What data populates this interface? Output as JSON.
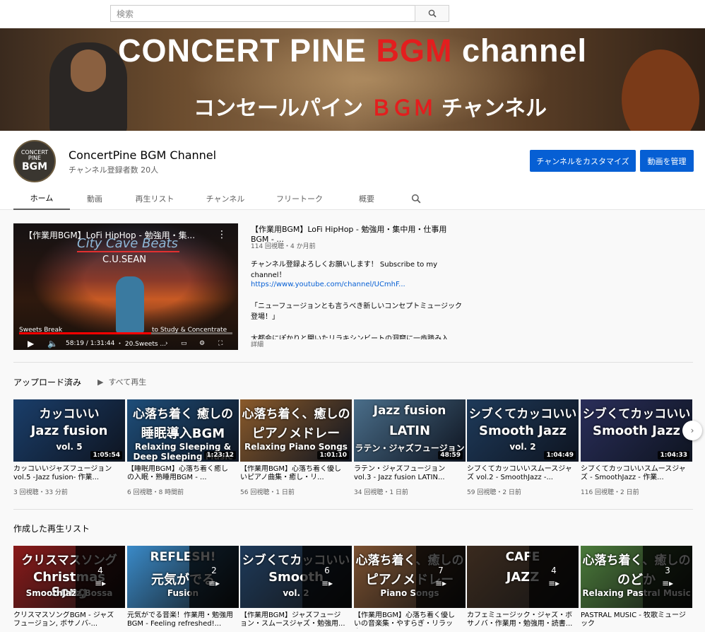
{
  "search": {
    "placeholder": "検索"
  },
  "banner": {
    "line1_a": "CONCERT PINE ",
    "line1_b": "BGM",
    "line1_c": " channel",
    "line2_a": "コンセールパイン ",
    "line2_b": "ＢＧＭ",
    "line2_c": " チャンネル"
  },
  "channel": {
    "avatar_top": "CONCERT",
    "avatar_mid": "PINE",
    "avatar_bottom": "BGM",
    "name": "ConcertPine BGM Channel",
    "subscribers": "チャンネル登録者数 20人",
    "customize_label": "チャンネルをカスタマイズ",
    "manage_label": "動画を管理"
  },
  "tabs": [
    {
      "label": "ホーム"
    },
    {
      "label": "動画"
    },
    {
      "label": "再生リスト"
    },
    {
      "label": "チャンネル"
    },
    {
      "label": "フリートーク"
    },
    {
      "label": "概要"
    }
  ],
  "featured": {
    "overlay_title": "【作業用BGM】LoFi HipHop - 勉強用・集...",
    "logo": "City Cave Beats",
    "artist": "C.U.SEAN",
    "caption_left": "Sweets Break",
    "caption_right": "to Study & Concentrate",
    "progress": 0.62,
    "time": "58:19 / 1:31:44",
    "chapter": "・ 20.Sweets ...",
    "title": "【作業用BGM】LoFi HipHop - 勉強用・集中用・仕事用 BGM - ...",
    "meta": "114 回視聴・4 か月前",
    "desc1": "チャンネル登録よろしくお願いします！ Subscribe to my channel！",
    "link": "https://www.youtube.com/channel/UCmhF...",
    "desc2": "「ニューフュージョンとも言うべき新しいコンセプトミュージック登場！」",
    "desc3": "大都会にぽかりと開いたリラキシンビートの洞窟に一歩踏み入",
    "more": "詳細"
  },
  "uploads": {
    "title": "アップロード済み",
    "play_all": "すべて再生",
    "items": [
      {
        "t1": "カッコいい",
        "t2": "Jazz fusion",
        "t3": "vol. 5",
        "duration": "1:05:54",
        "title": "カッコいいジャズフュージョン vol.5 -Jazz fusion- 作業...",
        "meta": "3 回視聴・33 分前",
        "color": "#1a3e6a"
      },
      {
        "t1": "心落ち着く 癒しの",
        "t2": "睡眠導入BGM",
        "t3": "Relaxing Sleeping & Deep Sleeping Music",
        "duration": "1:23:12",
        "title": "【睡眠用BGM】心落ち着く癒しの入眠・熟睡用BGM - ...",
        "meta": "6 回視聴・8 時間前",
        "color": "#1e4e7a"
      },
      {
        "t1": "心落ち着く、癒しの",
        "t2": "ピアノメドレー",
        "t3": "Relaxing Piano Songs",
        "duration": "1:01:10",
        "title": "【作業用BGM】心落ち着く優しいピアノ曲集・癒し・リ...",
        "meta": "56 回視聴・1 日前",
        "color": "#8a5a2a"
      },
      {
        "t1": "Jazz fusion",
        "t2": "LATIN",
        "t3": "ラテン・ジャズフュージョン",
        "duration": "48:59",
        "title": "ラテン・ジャズフュージョン vol.3 - Jazz fusion LATIN...",
        "meta": "34 回視聴・1 日前",
        "color": "#4a6e8a"
      },
      {
        "t1": "シブくてカッコいい",
        "t2": "Smooth Jazz",
        "t3": "vol. 2",
        "duration": "1:04:49",
        "title": "シブくてカッコいいスムースジャズ vol.2 - SmoothJazz -...",
        "meta": "59 回視聴・2 日前",
        "color": "#1e3a5a"
      },
      {
        "t1": "シブくてカッコいい",
        "t2": "Smooth Jazz",
        "t3": "",
        "duration": "1:04:33",
        "title": "シブくてカッコいいスムースジャズ - SmoothJazz - 作業...",
        "meta": "116 回視聴・2 日前",
        "color": "#2a2e5a"
      }
    ]
  },
  "playlists": {
    "title": "作成した再生リスト",
    "items": [
      {
        "t1": "クリスマスソング",
        "t2": "Christmas Song",
        "t3": "SmoothJazz,Bossa",
        "count": "4",
        "title": "クリスマスソングBGM - ジャズフュージョン, ボサノバ-...",
        "color": "#8a1a1a"
      },
      {
        "t1": "REFLESH!",
        "t2": "元気がでる",
        "t3": "Fusion",
        "count": "2",
        "title": "元気がでる音楽！作業用・勉強用BGM - Feeling refreshed!...",
        "color": "#3a8ac8"
      },
      {
        "t1": "シブくてカッコいい",
        "t2": "Smooth",
        "t3": "vol. 2",
        "count": "6",
        "title": "【作業用BGM】ジャズフュージョン・スムースジャズ・勉強用...",
        "color": "#1e3a5a"
      },
      {
        "t1": "心落ち着く、癒しの",
        "t2": "ピアノメドレー",
        "t3": "Piano Songs",
        "count": "7",
        "title": "【作業用BGM】心落ち着く優しいの音楽集・やすらぎ・リラック...",
        "color": "#7a5030"
      },
      {
        "t1": "CAFE",
        "t2": "JAZZ",
        "t3": "",
        "count": "4",
        "title": "カフェミュージック・ジャズ・ボサノバ・作業用・勉強用・読書...",
        "color": "#3a2a1e"
      },
      {
        "t1": "心落ち着く、癒しの",
        "t2": "のどか",
        "t3": "Relaxing Pastral Music",
        "count": "3",
        "title": "PASTRAL MUSIC - 牧歌ミュージック",
        "color": "#4a7a3a"
      }
    ]
  }
}
